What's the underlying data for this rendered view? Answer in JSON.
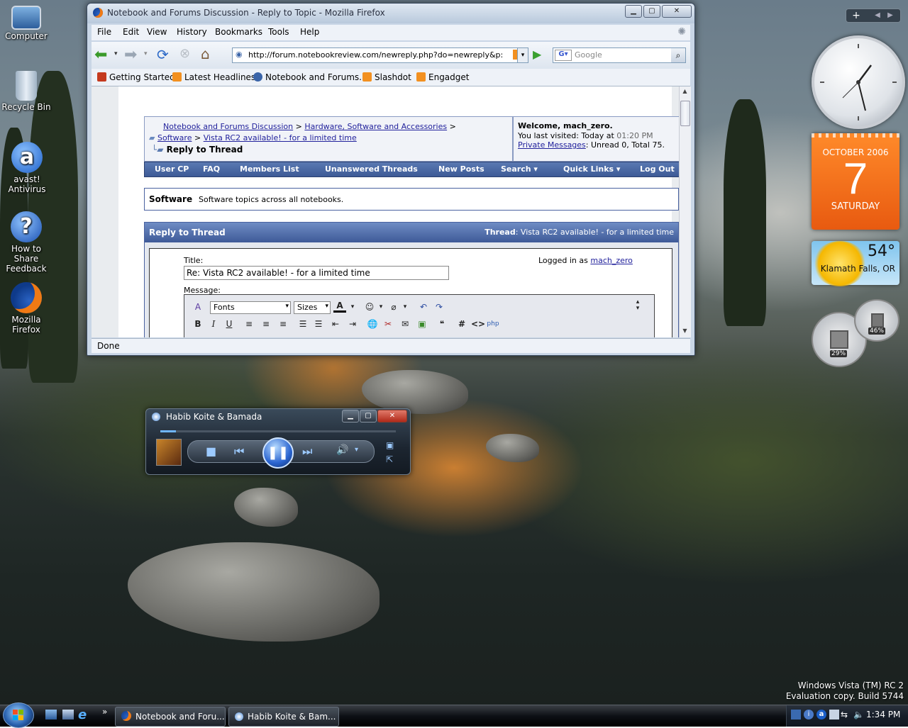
{
  "desktop": {
    "icons": [
      {
        "label": "Computer"
      },
      {
        "label": "Recycle Bin"
      },
      {
        "label": "avast! Antivirus"
      },
      {
        "label": "How to Share Feedback"
      },
      {
        "label": "Mozilla Firefox"
      }
    ],
    "watermark_line1": "Windows Vista (TM) RC 2",
    "watermark_line2": "Evaluation copy. Build 5744"
  },
  "firefox": {
    "title": "Notebook and Forums Discussion - Reply to Topic - Mozilla Firefox",
    "menu": [
      "File",
      "Edit",
      "View",
      "History",
      "Bookmarks",
      "Tools",
      "Help"
    ],
    "url": "http://forum.notebookreview.com/newreply.php?do=newreply&p:",
    "search_placeholder": "Google",
    "bookmarks": [
      "Getting Started",
      "Latest Headlines",
      "Notebook and Forums...",
      "Slashdot",
      "Engadget"
    ],
    "status": "Done",
    "page": {
      "breadcrumb_1": "Notebook and Forums Discussion",
      "breadcrumb_sep": ">",
      "breadcrumb_2": "Hardware, Software and Accessories",
      "breadcrumb_3": "Software",
      "breadcrumb_4": "Vista RC2 available! - for a limited time",
      "current": "Reply to Thread",
      "welcome": "Welcome, mach_zero.",
      "last_visited_label": "You last visited: Today at",
      "last_visited_time": "01:20 PM",
      "pm_link": "Private Messages",
      "pm_text": ": Unread 0, Total 75.",
      "nav": [
        "User CP",
        "FAQ",
        "Members List",
        "Unanswered Threads",
        "New Posts",
        "Search ▾",
        "Quick Links ▾",
        "Log Out"
      ],
      "forum_name": "Software",
      "forum_desc": "Software topics across all notebooks.",
      "reply_header": "Reply to Thread",
      "thread_label": "Thread",
      "thread_title": ": Vista RC2 available! - for a limited time",
      "title_label": "Title:",
      "title_value": "Re: Vista RC2 available! - for a limited time",
      "logged_in_label": "Logged in as",
      "logged_in_user": "mach_zero",
      "message_label": "Message:",
      "fonts_label": "Fonts",
      "sizes_label": "Sizes"
    }
  },
  "wmp": {
    "title": "Habib Koite & Bamada"
  },
  "gadgets": {
    "calendar_month": "OCTOBER 2006",
    "calendar_day": "7",
    "calendar_weekday": "SATURDAY",
    "weather_temp": "54°",
    "weather_location": "Klamath Falls, OR",
    "cpu_percent": "29%",
    "mem_percent": "46%"
  },
  "taskbar": {
    "tasks": [
      "Notebook and Foru...",
      "Habib Koite & Bam..."
    ],
    "time": "1:34 PM"
  },
  "colors": {
    "accent": "#3d5a96",
    "calendar": "#e85a10"
  }
}
